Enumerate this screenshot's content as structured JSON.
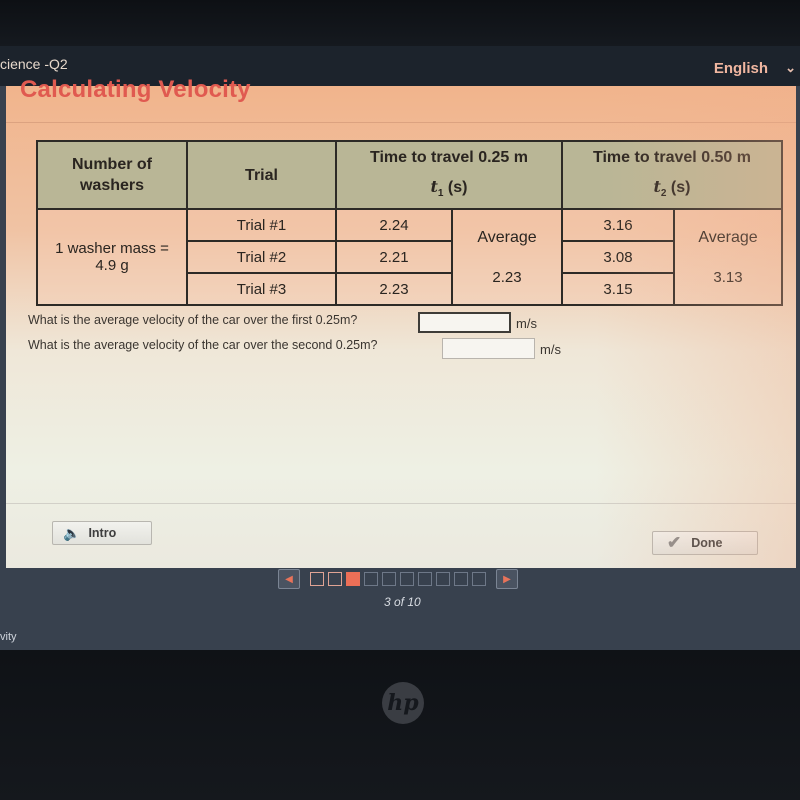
{
  "header": {
    "course_title": "cience -Q2",
    "language": "English",
    "language_chevron": "⌄"
  },
  "lesson": {
    "title": "Calculating Velocity"
  },
  "table": {
    "headers": {
      "washers": "Number of washers",
      "trial": "Trial",
      "t1_title": "Time to travel 0.25 m",
      "t1_var": "t",
      "t1_sub": "1",
      "t1_unit": " (s)",
      "t2_title": "Time to travel 0.50 m",
      "t2_var": "t",
      "t2_sub": "2",
      "t2_unit": " (s)"
    },
    "washer_label_line1": "1 washer mass =",
    "washer_label_line2": "4.9 g",
    "rows": [
      {
        "trial": "Trial #1",
        "t1": "2.24",
        "t2": "3.16"
      },
      {
        "trial": "Trial #2",
        "t1": "2.21",
        "t2": "3.08"
      },
      {
        "trial": "Trial #3",
        "t1": "2.23",
        "t2": "3.15"
      }
    ],
    "average_label": "Average",
    "t1_average": "2.23",
    "t2_average": "3.13"
  },
  "questions": [
    {
      "text": "What is the average velocity of the car over the first 0.25m?",
      "value": "",
      "unit": "m/s"
    },
    {
      "text": "What is the average velocity of the car over the second 0.25m?",
      "value": "",
      "unit": "m/s"
    }
  ],
  "buttons": {
    "intro": "Intro",
    "done": "Done"
  },
  "navigator": {
    "current": 3,
    "total": 10,
    "counter": "3 of 10",
    "slides": [
      "visited",
      "visited",
      "current",
      "unvisited",
      "unvisited",
      "unvisited",
      "unvisited",
      "unvisited",
      "unvisited",
      "unvisited"
    ]
  },
  "footer": {
    "label": "vity"
  },
  "device": {
    "logo": "hp"
  }
}
